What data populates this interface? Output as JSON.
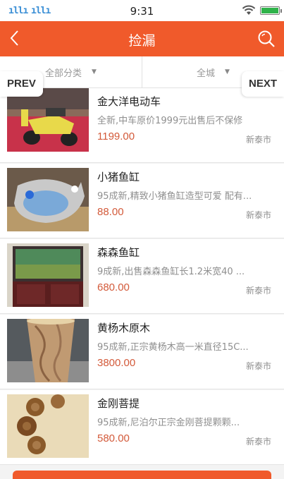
{
  "status_bar": {
    "signal_left": "",
    "signal_right": "",
    "time": "9:31"
  },
  "nav": {
    "back_icon": "chevron-left-icon",
    "title": "捡漏",
    "search_icon": "search-icon"
  },
  "filters": [
    {
      "label": "全部分类",
      "icon": "caret-down-icon"
    },
    {
      "label": "全城",
      "icon": "caret-down-icon"
    }
  ],
  "pager": {
    "prev": "PREV",
    "next": "NEXT"
  },
  "items": [
    {
      "title": "金大洋电动车",
      "desc": "全新,中车原价1999元出售后不保修",
      "price": "1199.00",
      "location": "新泰市",
      "thumb": "electric-scooter-photo"
    },
    {
      "title": "小猪鱼缸",
      "desc": "95成新,精致小猪鱼缸造型可爱 配有...",
      "price": "88.00",
      "location": "新泰市",
      "thumb": "pig-aquarium-photo"
    },
    {
      "title": "森森鱼缸",
      "desc": "9成新,出售森森鱼缸长1.2米宽40 ...",
      "price": "680.00",
      "location": "新泰市",
      "thumb": "aquarium-cabinet-photo"
    },
    {
      "title": "黄杨木原木",
      "desc": "95成新,正宗黄杨木高一米直径15C...",
      "price": "3800.00",
      "location": "新泰市",
      "thumb": "boxwood-log-photo"
    },
    {
      "title": "金刚菩提",
      "desc": "95成新,尼泊尔正宗金刚菩提颗颗...",
      "price": "580.00",
      "location": "新泰市",
      "thumb": "bodhi-beads-photo"
    }
  ],
  "bottom_button": {
    "label": ""
  },
  "colors": {
    "brand": "#f05a2b",
    "price": "#d35a3a"
  }
}
